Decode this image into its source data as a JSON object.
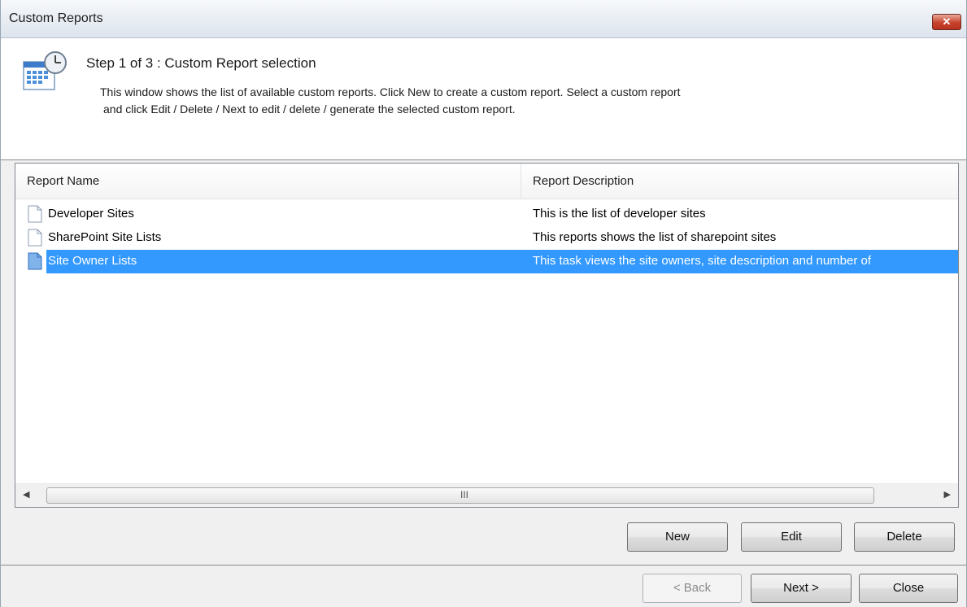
{
  "window": {
    "title": "Custom Reports",
    "close_glyph": "✕"
  },
  "header": {
    "icon": "calendar-clock-icon",
    "step_title": "Step 1 of 3 : Custom Report selection",
    "description_line1": "This window shows the list of available custom reports. Click New to create a custom report. Select a custom report",
    "description_line2": "and click Edit / Delete / Next to edit / delete / generate the selected custom report."
  },
  "list": {
    "columns": [
      "Report Name",
      "Report Description"
    ],
    "rows": [
      {
        "name": "Developer Sites",
        "description": "This is the list of developer sites",
        "selected": false
      },
      {
        "name": "SharePoint Site Lists",
        "description": "This reports shows the list of sharepoint sites",
        "selected": false
      },
      {
        "name": "Site Owner Lists",
        "description": "This task views the site owners, site description and number of",
        "selected": true
      }
    ],
    "scroll_grip": "III"
  },
  "actions": {
    "new_label": "New",
    "edit_label": "Edit",
    "delete_label": "Delete"
  },
  "wizard": {
    "back_label": "< Back",
    "next_label": "Next >",
    "close_label": "Close",
    "back_enabled": false
  },
  "colors": {
    "selection": "#3399ff",
    "close_button": "#c7432c"
  }
}
